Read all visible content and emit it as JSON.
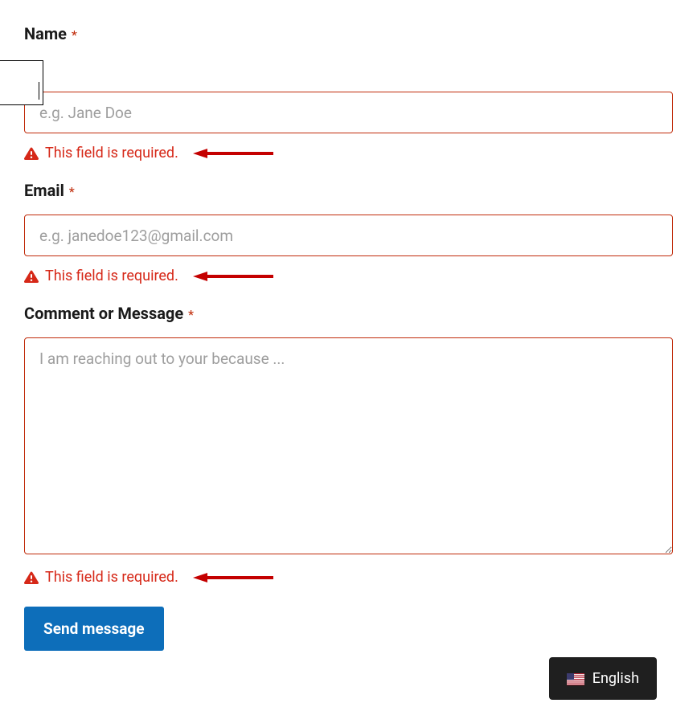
{
  "fields": {
    "name": {
      "label": "Name",
      "placeholder": "e.g. Jane Doe",
      "error": "This field is required."
    },
    "email": {
      "label": "Email",
      "placeholder": "e.g. janedoe123@gmail.com",
      "error": "This field is required."
    },
    "message": {
      "label": "Comment or Message",
      "placeholder": "I am reaching out to your because ...",
      "error": "This field is required."
    }
  },
  "required_marker": "*",
  "submit_label": "Send message",
  "language": {
    "label": "English"
  },
  "colors": {
    "error": "#d62818",
    "input_border_error": "#c02b0a",
    "submit_bg": "#0d6eba",
    "submit_fg": "#ffffff",
    "lang_bg": "#1f1f1f"
  }
}
